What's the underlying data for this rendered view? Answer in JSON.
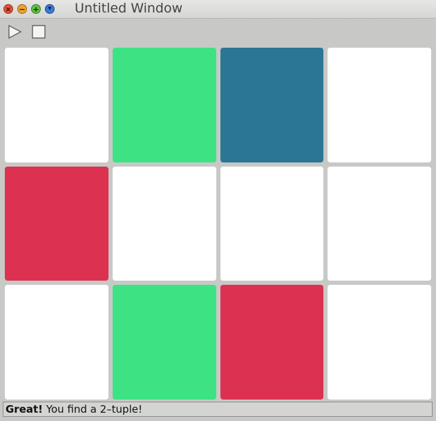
{
  "window": {
    "title": "Untitled Window",
    "buttons": {
      "close_glyph": "×",
      "minimize_glyph": "−",
      "maximize_glyph": "+",
      "menu_glyph": "▾"
    }
  },
  "toolbar": {
    "play_icon": "play-icon",
    "stop_icon": "stop-icon"
  },
  "grid": {
    "rows": 3,
    "columns": 4,
    "cards": [
      {
        "color": "#ffffff"
      },
      {
        "color": "#3de383"
      },
      {
        "color": "#2b7595"
      },
      {
        "color": "#ffffff"
      },
      {
        "color": "#dc3150"
      },
      {
        "color": "#ffffff"
      },
      {
        "color": "#ffffff"
      },
      {
        "color": "#ffffff"
      },
      {
        "color": "#ffffff"
      },
      {
        "color": "#3de383"
      },
      {
        "color": "#dc3150"
      },
      {
        "color": "#ffffff"
      }
    ]
  },
  "status": {
    "bold": "Great!",
    "message": " You find a 2–tuple!"
  }
}
